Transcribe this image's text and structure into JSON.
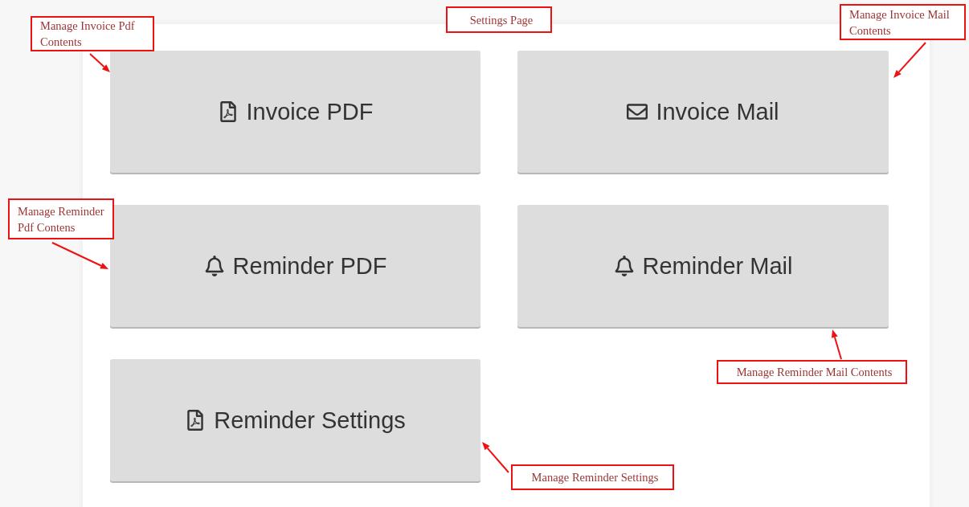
{
  "tiles": [
    {
      "label": "Invoice PDF",
      "kind": "pdf"
    },
    {
      "label": "Invoice Mail",
      "kind": "mail"
    },
    {
      "label": "Reminder PDF",
      "kind": "bell"
    },
    {
      "label": "Reminder Mail",
      "kind": "bell"
    },
    {
      "label": "Reminder Settings",
      "kind": "pdf"
    }
  ],
  "annotations": [
    {
      "text": "Manage Invoice Pdf Contents"
    },
    {
      "text": "Settings Page"
    },
    {
      "text": "Manage Invoice Mail Contents"
    },
    {
      "text": "Manage Reminder Pdf Contens"
    },
    {
      "text": "Manage Reminder Mail Contents"
    },
    {
      "text": "Manage Reminder Settings"
    }
  ]
}
